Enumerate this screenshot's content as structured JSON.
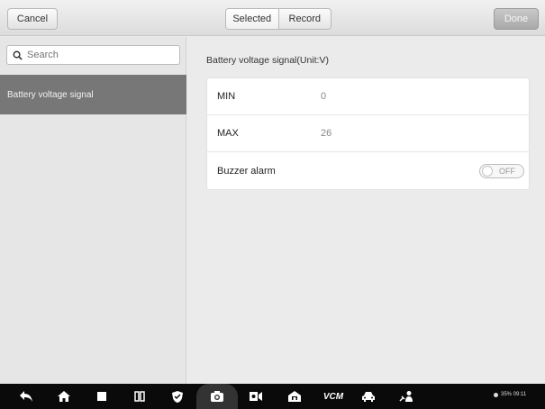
{
  "topbar": {
    "cancel_label": "Cancel",
    "tabs": [
      {
        "label": "Selected",
        "active": true
      },
      {
        "label": "Record",
        "active": false
      }
    ],
    "done_label": "Done"
  },
  "sidebar": {
    "search_placeholder": "Search",
    "items": [
      {
        "label": "Battery voltage signal",
        "selected": true
      }
    ]
  },
  "detail": {
    "section_title": "Battery voltage signal(Unit:V)",
    "rows": [
      {
        "label": "MIN",
        "value": "0"
      },
      {
        "label": "MAX",
        "value": "26"
      },
      {
        "label": "Buzzer alarm",
        "toggle": "OFF"
      }
    ]
  },
  "taskbar": {
    "icons": [
      "back-icon",
      "home-icon",
      "recent-apps-icon",
      "split-screen-icon",
      "shield-icon",
      "camera-icon",
      "screen-record-icon",
      "home-garage-icon",
      "vcm-icon",
      "car-icon",
      "mechanic-icon"
    ],
    "vcm_label": "VCM",
    "status_text": "35% 09:11"
  },
  "colors": {
    "selected_item_bg": "#777777",
    "taskbar_bg": "#0a0a0a",
    "done_bg": "#b5b5b5"
  }
}
